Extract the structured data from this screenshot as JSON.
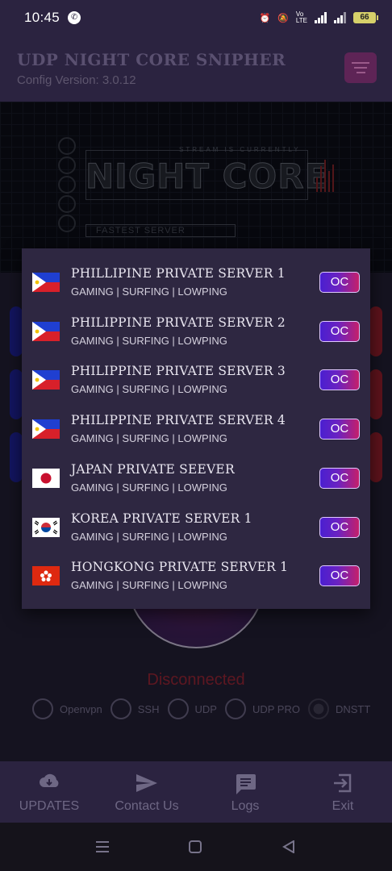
{
  "statusbar": {
    "time": "10:45",
    "battery": "66"
  },
  "app": {
    "title": "UDP NIGHT CORE SNIPHER",
    "config_version": "Config Version: 3.0.12"
  },
  "banner": {
    "headline": "NIGHT CORE",
    "stream_text": "STREAM IS CURRENTLY",
    "fastest_text": "FASTEST SERVER"
  },
  "server_dialog": {
    "servers": [
      {
        "name": "PHILLIPINE PRIVATE SERVER 1",
        "desc": "GAMING | SURFING | LOWPING",
        "flag": "philippines-flag",
        "badge": "OC"
      },
      {
        "name": "PHILIPPINE PRIVATE SERVER 2",
        "desc": "GAMING | SURFING | LOWPING",
        "flag": "philippines-flag",
        "badge": "OC"
      },
      {
        "name": "PHILIPPINE PRIVATE SERVER 3",
        "desc": "GAMING | SURFING | LOWPING",
        "flag": "philippines-flag",
        "badge": "OC"
      },
      {
        "name": "PHILIPPINE PRIVATE SERVER 4",
        "desc": "GAMING | SURFING | LOWPING",
        "flag": "philippines-flag",
        "badge": "OC"
      },
      {
        "name": "JAPAN PRIVATE SEEVER",
        "desc": "GAMING | SURFING | LOWPING",
        "flag": "japan-flag",
        "badge": "OC"
      },
      {
        "name": "KOREA PRIVATE SERVER 1",
        "desc": "GAMING | SURFING | LOWPING",
        "flag": "korea-flag",
        "badge": "OC"
      },
      {
        "name": "HONGKONG PRIVATE SERVER 1",
        "desc": "GAMING | SURFING | LOWPING",
        "flag": "hongkong-flag",
        "badge": "OC"
      }
    ]
  },
  "connection": {
    "status": "Disconnected",
    "protocols": [
      "Openvpn",
      "SSH",
      "UDP",
      "UDP PRO",
      "DNSTT"
    ],
    "selected_protocol": "DNSTT"
  },
  "bottom_nav": {
    "updates": "UPDATES",
    "contact": "Contact Us",
    "logs": "Logs",
    "exit": "Exit"
  },
  "colors": {
    "header_bg": "#2b2340",
    "dialog_bg": "#2e2741",
    "badge_start": "#4a1fd0",
    "badge_end": "#c5206a",
    "status_red": "#8a1f2a"
  }
}
